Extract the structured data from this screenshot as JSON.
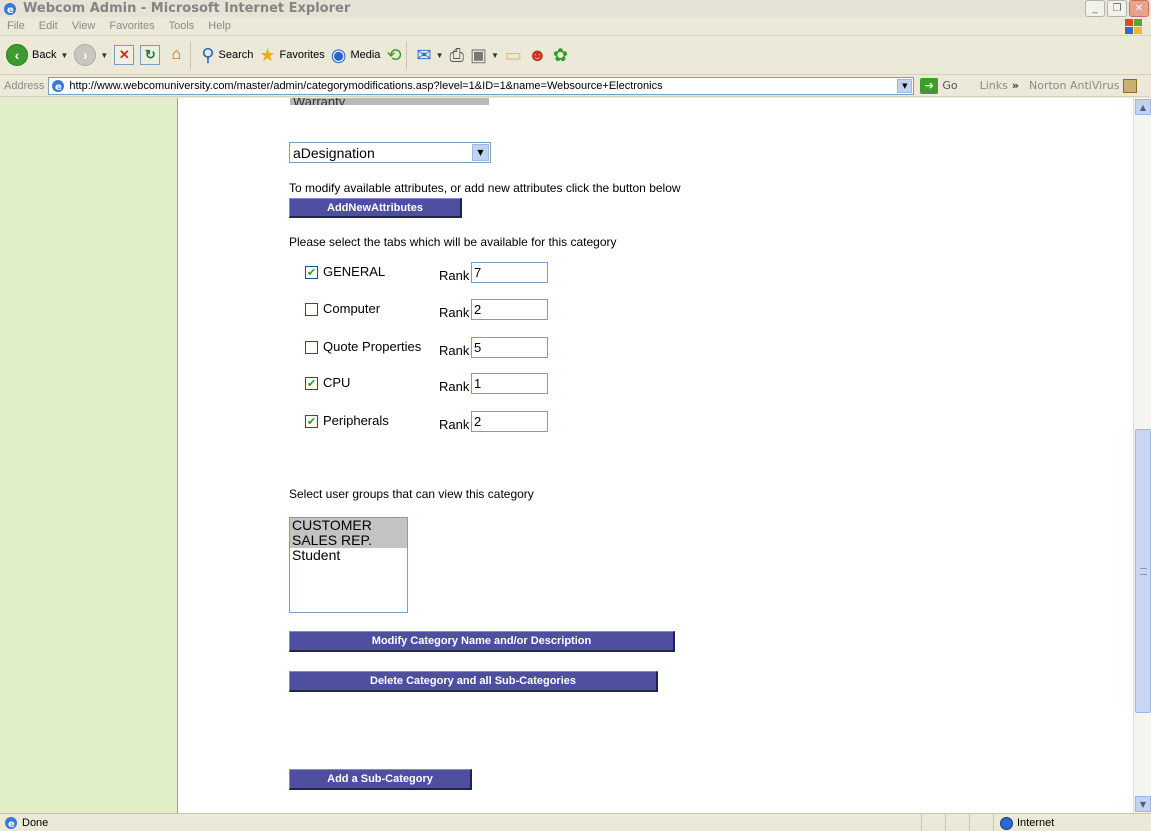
{
  "window": {
    "title": "Webcom Admin - Microsoft Internet Explorer"
  },
  "menu": [
    "File",
    "Edit",
    "View",
    "Favorites",
    "Tools",
    "Help"
  ],
  "toolbar": {
    "back": "Back",
    "search": "Search",
    "favorites": "Favorites",
    "media": "Media"
  },
  "address": {
    "label": "Address",
    "url": "http://www.webcomuniversity.com/master/admin/categorymodifications.asp?level=1&ID=1&name=Websource+Electronics",
    "go": "Go",
    "links": "Links",
    "norton": "Norton AntiVirus"
  },
  "form": {
    "partial_option": "Warranty",
    "attribute_select": "aDesignation",
    "modify_attr_text": "To modify available attributes, or add new attributes click the button below",
    "add_attr_button": "AddNewAttributes",
    "tabs_prompt": "Please select the tabs which will be available for this category",
    "rank_label": "Rank",
    "tabs": [
      {
        "label": "GENERAL",
        "checked": true,
        "rank": "7"
      },
      {
        "label": "Computer",
        "checked": false,
        "rank": "2"
      },
      {
        "label": "Quote Properties",
        "checked": false,
        "rank": "5"
      },
      {
        "label": "CPU",
        "checked": true,
        "rank": "1"
      },
      {
        "label": "Peripherals",
        "checked": true,
        "rank": "2"
      }
    ],
    "groups_prompt": "Select user groups that can view this category",
    "user_groups": [
      {
        "label": "CUSTOMER",
        "selected": true
      },
      {
        "label": "SALES REP.",
        "selected": true
      },
      {
        "label": "Student",
        "selected": false
      }
    ],
    "modify_button": "Modify Category Name and/or Description",
    "delete_button": "Delete Category and all Sub-Categories",
    "add_sub_button": "Add a Sub-Category"
  },
  "status": {
    "text": "Done",
    "zone": "Internet"
  },
  "colors": {
    "sidebar": "#e1efc8",
    "button": "#4f4fa0",
    "check": "#21a121"
  }
}
